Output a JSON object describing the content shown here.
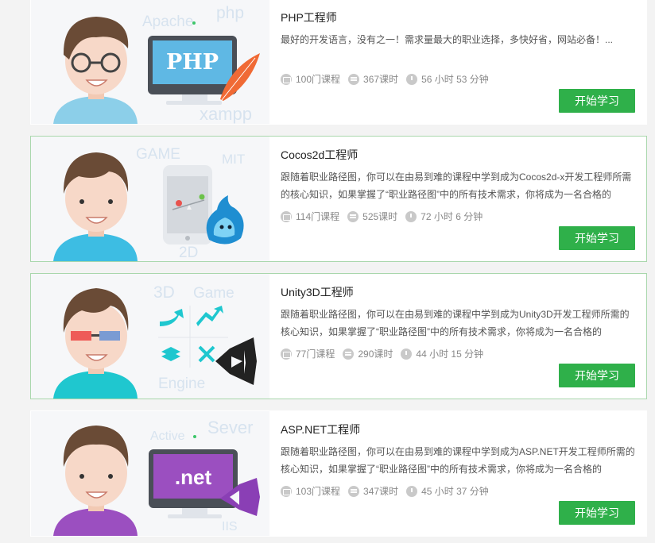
{
  "paths": [
    {
      "title": "PHP工程师",
      "description": "最好的开发语言，没有之一！需求量最大的职业选择，多快好省，网站必备！...",
      "courses": "100门课程",
      "lessons": "367课时",
      "duration": "56 小时 53 分钟",
      "button": "开始学习",
      "thumb_words": [
        "Apache",
        "php",
        "xampp"
      ],
      "screen_text": "PHP",
      "shirt_color": "#8ccfe9"
    },
    {
      "title": "Cocos2d工程师",
      "description": "跟随着职业路径图，你可以在由易到难的课程中学到成为Cocos2d-x开发工程师所需的核心知识，如果掌握了“职业路径图”中的所有技术需求，你将成为一名合格的",
      "courses": "114门课程",
      "lessons": "525课时",
      "duration": "72 小时 6 分钟",
      "button": "开始学习",
      "thumb_words": [
        "GAME",
        "MIT",
        "2D"
      ],
      "shirt_color": "#3dbde3"
    },
    {
      "title": "Unity3D工程师",
      "description": "跟随着职业路径图，你可以在由易到难的课程中学到成为Unity3D开发工程师所需的核心知识，如果掌握了“职业路径图”中的所有技术需求，你将成为一名合格的",
      "courses": "77门课程",
      "lessons": "290课时",
      "duration": "44 小时 15 分钟",
      "button": "开始学习",
      "thumb_words": [
        "3D",
        "Game",
        "Engine"
      ],
      "shirt_color": "#1fc7cf"
    },
    {
      "title": "ASP.NET工程师",
      "description": "跟随着职业路径图，你可以在由易到难的课程中学到成为ASP.NET开发工程师所需的核心知识，如果掌握了“职业路径图”中的所有技术需求，你将成为一名合格的",
      "courses": "103门课程",
      "lessons": "347课时",
      "duration": "45 小时 37 分钟",
      "button": "开始学习",
      "thumb_words": [
        "Active",
        "Sever",
        "IIS"
      ],
      "screen_text": ".net",
      "shirt_color": "#9b4fc0"
    }
  ],
  "colors": {
    "accent": "#2fb04a",
    "active_border": "#a9d7ac"
  }
}
